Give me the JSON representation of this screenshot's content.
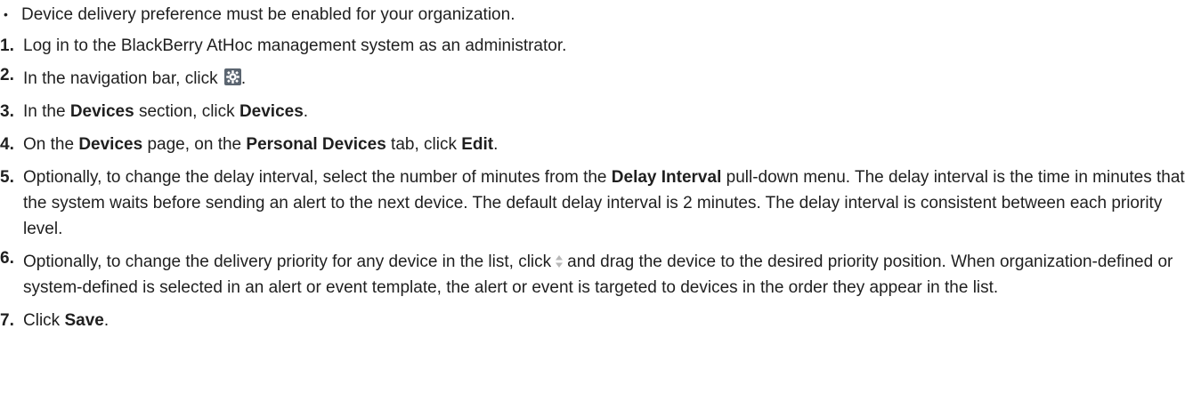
{
  "prereq": {
    "bullet": "•",
    "text": "Device delivery preference must be enabled for your organization."
  },
  "steps": [
    {
      "num": "1.",
      "text": "Log in to the BlackBerry AtHoc management system as an administrator."
    },
    {
      "num": "2.",
      "before": "In the navigation bar, click",
      "icon": "gear-icon",
      "after": "."
    },
    {
      "num": "3.",
      "t1": "In the ",
      "b1": "Devices",
      "t2": " section, click ",
      "b2": "Devices",
      "t3": "."
    },
    {
      "num": "4.",
      "t1": "On the ",
      "b1": "Devices",
      "t2": " page, on the ",
      "b2": "Personal Devices",
      "t3": " tab, click ",
      "b3": "Edit",
      "t4": "."
    },
    {
      "num": "5.",
      "t1": "Optionally, to change the delay interval, select the number of minutes from the ",
      "b1": "Delay Interval",
      "t2": " pull-down menu. The delay interval is the time in minutes that the system waits before sending an alert to the next device. The default delay interval is 2 minutes. The delay interval is consistent between each priority level."
    },
    {
      "num": "6.",
      "t1": "Optionally, to change the delivery priority for any device in the list, click",
      "icon": "sort-icon",
      "t2": "and drag the device to the desired priority position. When organization-defined or system-defined is selected in an alert or event template, the alert or event is targeted to devices in the order they appear in the list."
    },
    {
      "num": "7.",
      "t1": "Click ",
      "b1": "Save",
      "t2": "."
    }
  ]
}
